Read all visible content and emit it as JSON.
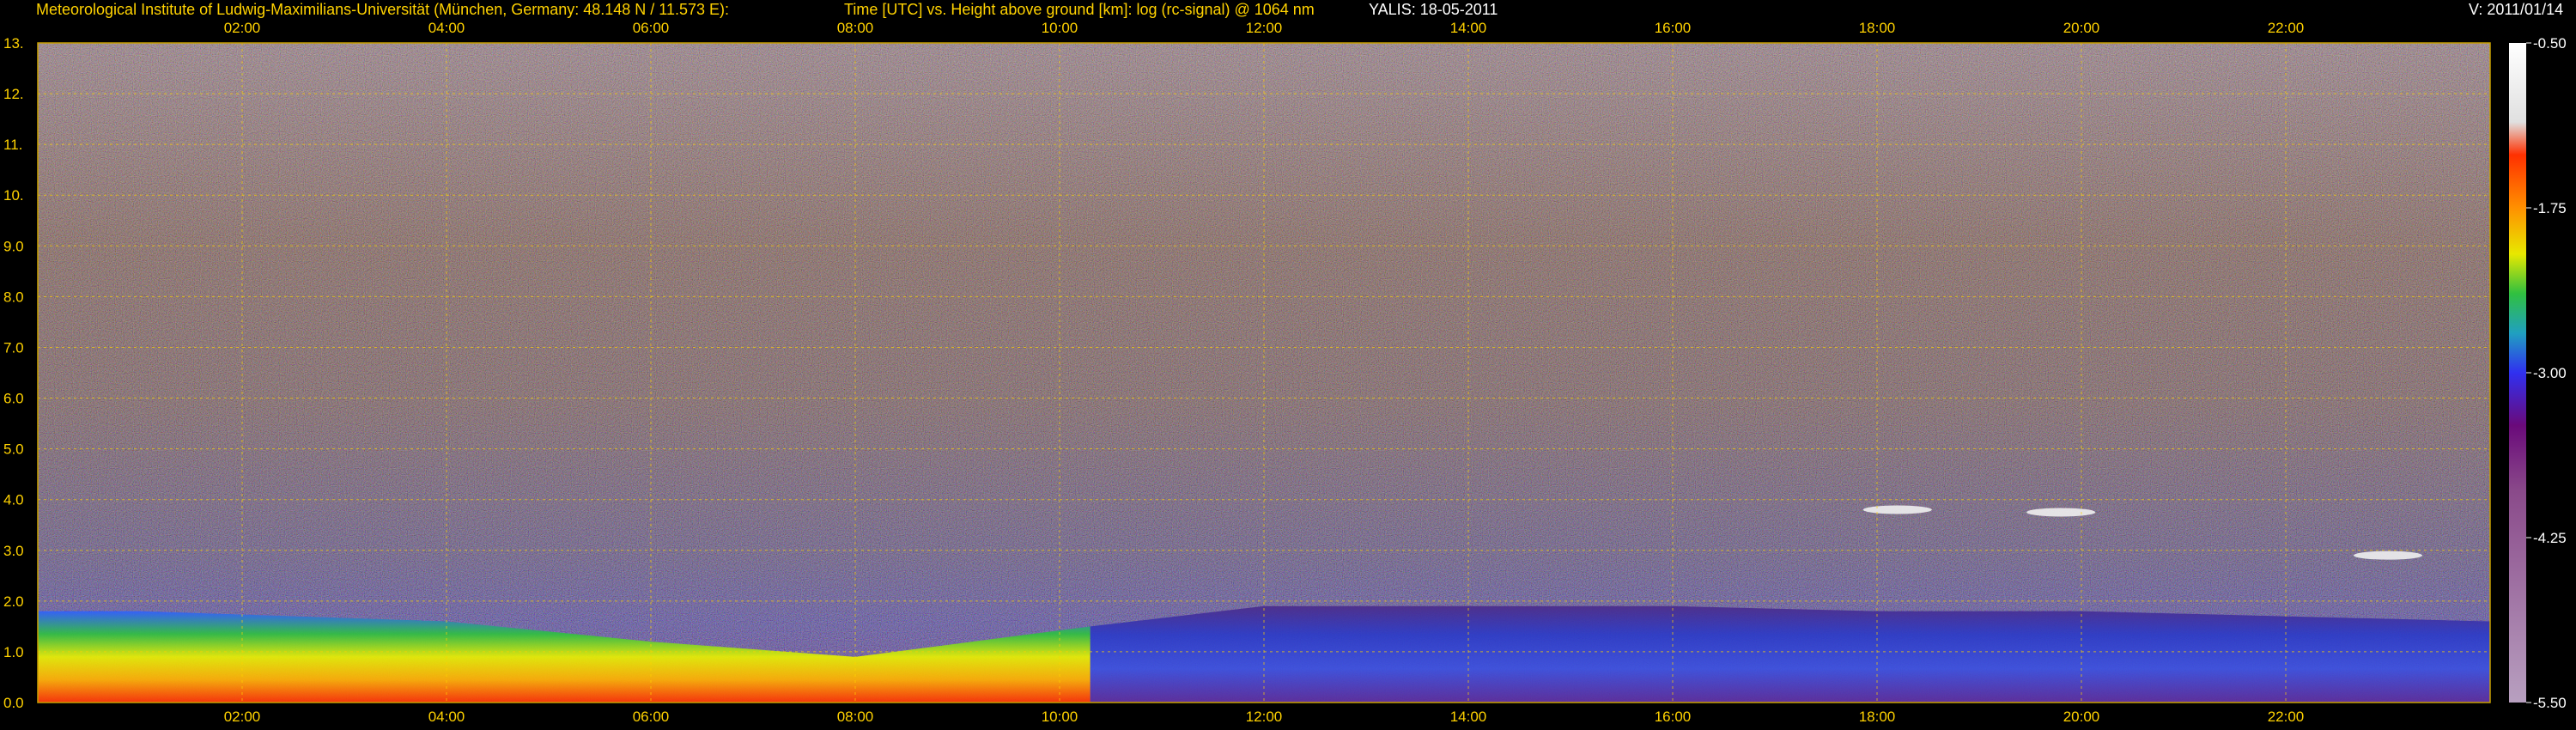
{
  "header": {
    "institute": "Meteorological Institute of Ludwig-Maximilians-Universität (München, Germany: 48.148 N / 11.573 E):",
    "plot_desc": "Time [UTC] vs. Height above ground [km]: log (rc-signal) @ 1064 nm",
    "instrument_date": "YALIS: 18-05-2011",
    "version": "V: 2011/01/14"
  },
  "colors": {
    "background": "#000000",
    "text": "#ffd200",
    "grid": "#ffd200",
    "border": "#c8a000"
  },
  "chart_data": {
    "type": "heatmap",
    "title": "Time [UTC] vs. Height above ground [km]: log (rc-signal) @ 1064 nm",
    "x_ticks": [
      "02:00",
      "04:00",
      "06:00",
      "08:00",
      "10:00",
      "12:00",
      "14:00",
      "16:00",
      "18:00",
      "20:00",
      "22:00"
    ],
    "x_tick_hours": [
      2,
      4,
      6,
      8,
      10,
      12,
      14,
      16,
      18,
      20,
      22
    ],
    "xlim_hours": [
      0,
      24
    ],
    "y_ticks": [
      "0.0",
      "1.0",
      "2.0",
      "3.0",
      "4.0",
      "5.0",
      "6.0",
      "7.0",
      "8.0",
      "9.0",
      "10.",
      "11.",
      "12.",
      "13."
    ],
    "y_tick_values": [
      0,
      1,
      2,
      3,
      4,
      5,
      6,
      7,
      8,
      9,
      10,
      11,
      12,
      13
    ],
    "ylim_km": [
      0,
      13
    ],
    "grid": true,
    "colorbar": {
      "tick_labels": [
        "-0.50",
        "-1.75",
        "-3.00",
        "-4.25",
        "-5.50"
      ],
      "tick_values": [
        -0.5,
        -1.75,
        -3.0,
        -4.25,
        -5.5
      ],
      "range": [
        -5.5,
        -0.5
      ]
    },
    "aerosol_layer_top_km": [
      {
        "hour": 0.0,
        "km": 1.8
      },
      {
        "hour": 1.0,
        "km": 1.8
      },
      {
        "hour": 4.0,
        "km": 1.6
      },
      {
        "hour": 6.0,
        "km": 1.2
      },
      {
        "hour": 8.0,
        "km": 0.9
      },
      {
        "hour": 10.3,
        "km": 1.5
      },
      {
        "hour": 12.0,
        "km": 1.9
      },
      {
        "hour": 14.0,
        "km": 1.9
      },
      {
        "hour": 16.0,
        "km": 1.9
      },
      {
        "hour": 18.0,
        "km": 1.8
      },
      {
        "hour": 20.0,
        "km": 1.8
      },
      {
        "hour": 22.0,
        "km": 1.7
      },
      {
        "hour": 24.0,
        "km": 1.6
      }
    ],
    "cloud_patches": [
      {
        "hour": 18.2,
        "km": 3.8
      },
      {
        "hour": 19.8,
        "km": 3.75
      },
      {
        "hour": 23.0,
        "km": 2.9
      }
    ]
  }
}
